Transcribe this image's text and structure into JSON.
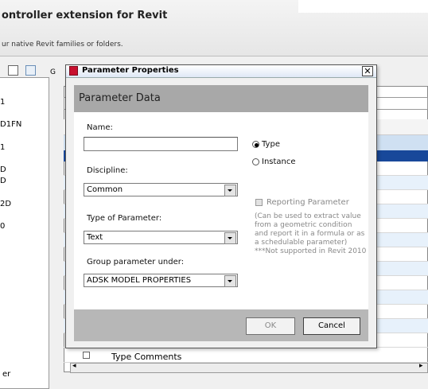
{
  "app": {
    "title": "ontroller extension for Revit",
    "subtitle": "ur native Revit families or folders.",
    "tab_fragment": "G",
    "list_items": [
      "1",
      "D1FN",
      "1",
      "D",
      "D",
      "2D",
      "0"
    ],
    "bottom_left_label": "er",
    "grid_row_label": "Type Comments"
  },
  "dialog": {
    "title": "Parameter Properties",
    "close_glyph": "✕",
    "header": "Parameter Data",
    "name_label": "Name:",
    "name_value": "",
    "discipline_label": "Discipline:",
    "discipline_value": "Common",
    "type_label": "Type of Parameter:",
    "type_value": "Text",
    "group_label": "Group parameter under:",
    "group_value": "ADSK MODEL PROPERTIES",
    "radio_type": "Type",
    "radio_instance": "Instance",
    "selected_radio": "Type",
    "reporting_label": "Reporting Parameter",
    "reporting_note": "(Can be used to extract value from a geometric condition and report it in a formula or as a schedulable parameter) ***Not supported in Revit 2010",
    "ok_label": "OK",
    "cancel_label": "Cancel"
  },
  "colors": {
    "selected_row": "#18489a",
    "dialog_icon": "#c8102e",
    "header_band": "#a8a8a8"
  }
}
